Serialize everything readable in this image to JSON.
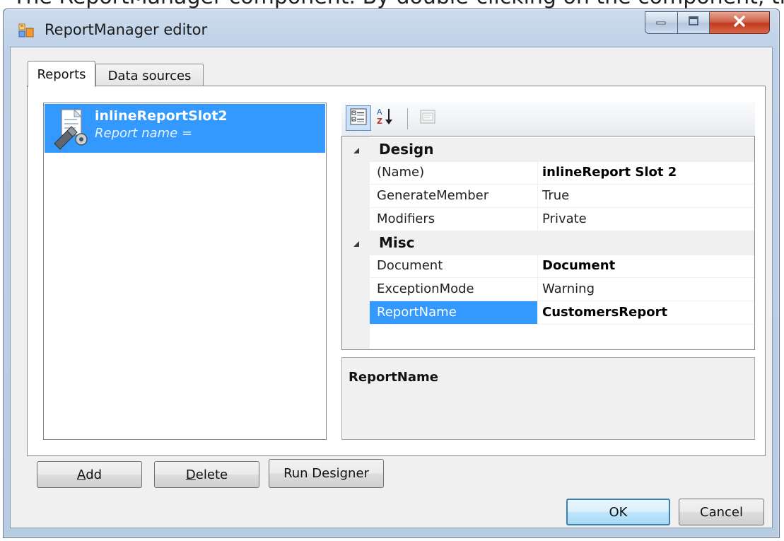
{
  "context": {
    "cropped_text": "The ReportManager component. By double-clicking on the component, the editor dialog opens"
  },
  "window": {
    "title": "ReportManager editor",
    "icon": "window-app-icon",
    "controls": [
      "minimize-icon",
      "maximize-icon",
      "close-icon"
    ]
  },
  "tabs": [
    {
      "label": "Reports",
      "active": true
    },
    {
      "label": "Data sources",
      "active": false
    }
  ],
  "report_list": {
    "items": [
      {
        "title": "inlineReportSlot2",
        "subtitle": "Report name =",
        "selected": true,
        "icon": "report-component-icon"
      }
    ]
  },
  "property_grid": {
    "toolbar": {
      "categorized_icon": "categorized-view-icon",
      "alphabetical_icon": "alphabetical-sort-icon",
      "property_pages_icon": "property-pages-icon"
    },
    "categories": [
      {
        "name": "Design",
        "properties": [
          {
            "name": "(Name)",
            "value": "inlineReport Slot 2",
            "bold": true
          },
          {
            "name": "GenerateMember",
            "value": "True",
            "bold": false
          },
          {
            "name": "Modifiers",
            "value": "Private",
            "bold": false
          }
        ]
      },
      {
        "name": "Misc",
        "properties": [
          {
            "name": "Document",
            "value": "Document",
            "bold": true
          },
          {
            "name": "ExceptionMode",
            "value": "Warning",
            "bold": false
          },
          {
            "name": "ReportName",
            "value": "CustomersReport",
            "bold": true,
            "selected": true
          }
        ]
      }
    ],
    "help": {
      "title": "ReportName"
    }
  },
  "buttons": {
    "add_prefix": "A",
    "add_rest": "dd",
    "delete_prefix": "D",
    "delete_rest": "elete",
    "run_designer": "Run Designer",
    "ok": "OK",
    "cancel": "Cancel"
  },
  "colors": {
    "selection": "#3399ff",
    "window_frame": "#b9cde5"
  }
}
